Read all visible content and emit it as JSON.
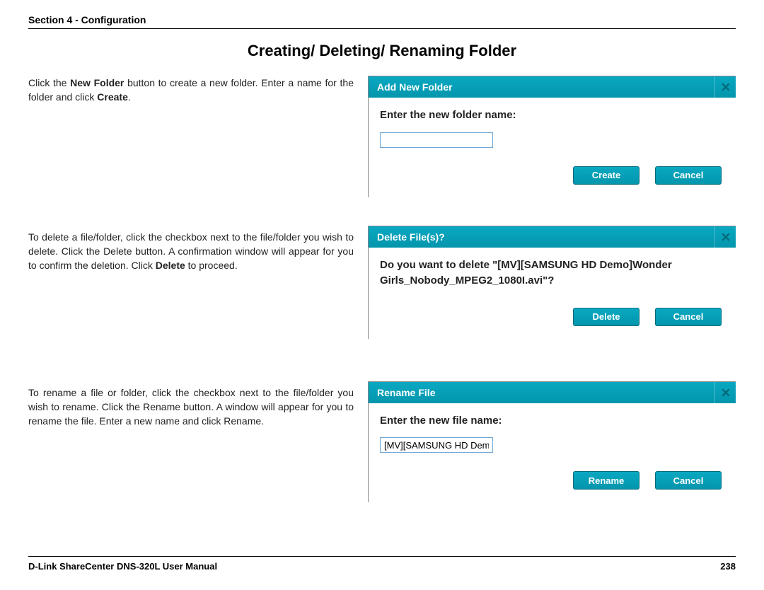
{
  "header": {
    "section": "Section 4 - Configuration"
  },
  "title": "Creating/ Deleting/ Renaming Folder",
  "create": {
    "text_parts": [
      "Click the ",
      "New Folder",
      " button to create a new folder. Enter a name for the folder and click ",
      "Create",
      "."
    ],
    "dialog": {
      "title": "Add New Folder",
      "prompt": "Enter the new folder name:",
      "input_value": "",
      "btn_primary": "Create",
      "btn_cancel": "Cancel"
    }
  },
  "delete": {
    "text_parts": [
      "To delete a file/folder, click the checkbox next to the file/folder you wish to delete. Click the Delete button. A confirmation window will appear for you to confirm the deletion. Click ",
      "Delete",
      " to proceed."
    ],
    "dialog": {
      "title": "Delete File(s)?",
      "prompt": "Do you want to delete \"[MV][SAMSUNG HD Demo]Wonder Girls_Nobody_MPEG2_1080I.avi\"?",
      "btn_primary": "Delete",
      "btn_cancel": "Cancel"
    }
  },
  "rename": {
    "text_parts": [
      "To rename a file or folder, click the checkbox next to the file/folder you wish to rename. Click the Rename button. A window will appear for you to rename the file. Enter a new name and click Rename."
    ],
    "dialog": {
      "title": "Rename File",
      "prompt": "Enter the new file name:",
      "input_value": "[MV][SAMSUNG HD Dem",
      "btn_primary": "Rename",
      "btn_cancel": "Cancel"
    }
  },
  "footer": {
    "manual": "D-Link ShareCenter DNS-320L User Manual",
    "page": "238"
  },
  "icons": {
    "close": "×"
  }
}
